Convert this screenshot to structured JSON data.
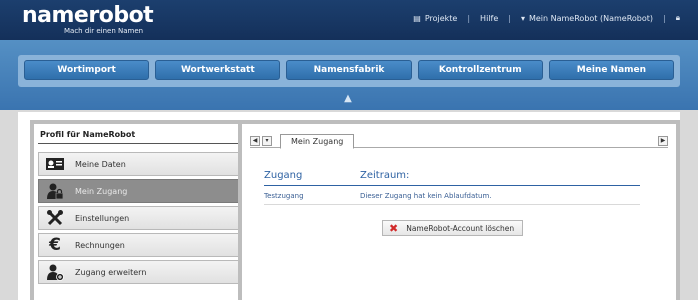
{
  "brand": {
    "name_part": "name",
    "robot_part": "robot",
    "tagline": "Mach dir einen Namen"
  },
  "topnav": {
    "projects": "Projekte",
    "help": "Hilfe",
    "account": "Mein NameRobot (NameRobot)",
    "separator": "|"
  },
  "main_tabs": [
    "Wortimport",
    "Wortwerkstatt",
    "Namensfabrik",
    "Kontrollzentrum",
    "Meine Namen"
  ],
  "profile": {
    "title": "Profil für NameRobot",
    "items": [
      {
        "label": "Meine Daten",
        "icon": "id-card-icon",
        "active": false
      },
      {
        "label": "Mein Zugang",
        "icon": "user-lock-icon",
        "active": true
      },
      {
        "label": "Einstellungen",
        "icon": "tools-icon",
        "active": false
      },
      {
        "label": "Rechnungen",
        "icon": "euro-icon",
        "active": false
      },
      {
        "label": "Zugang erweitern",
        "icon": "user-add-icon",
        "active": false
      }
    ]
  },
  "panel": {
    "tab_label": "Mein Zugang",
    "table": {
      "headers": [
        "Zugang",
        "Zeitraum:"
      ],
      "rows": [
        [
          "Testzugang",
          "Dieser Zugang hat kein Ablaufdatum."
        ]
      ]
    },
    "delete_label": "NameRobot-Account löschen"
  },
  "colors": {
    "header": "#1c3f6e",
    "band": "#4a83bd",
    "accent": "#2e62a3"
  }
}
